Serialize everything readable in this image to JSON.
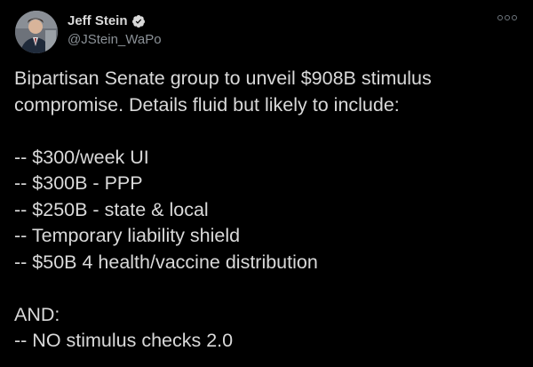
{
  "author": {
    "display_name": "Jeff Stein",
    "handle": "@JStein_WaPo",
    "verified": true,
    "avatar_icon": "profile-photo-icon"
  },
  "menu": {
    "icon": "more-options-icon"
  },
  "tweet": {
    "lines": [
      "Bipartisan Senate group to unveil $908B stimulus",
      "compromise. Details fluid but likely to include:",
      "",
      "-- $300/week UI",
      "-- $300B - PPP",
      "-- $250B - state & local",
      "-- Temporary liability shield",
      "-- $50B 4 health/vaccine distribution",
      "",
      "AND:",
      "-- NO stimulus checks 2.0"
    ]
  },
  "colors": {
    "background": "#000000",
    "text": "#d9d9d9",
    "secondary_text": "#8b9197",
    "verified_badge": "#d9d9d9"
  }
}
